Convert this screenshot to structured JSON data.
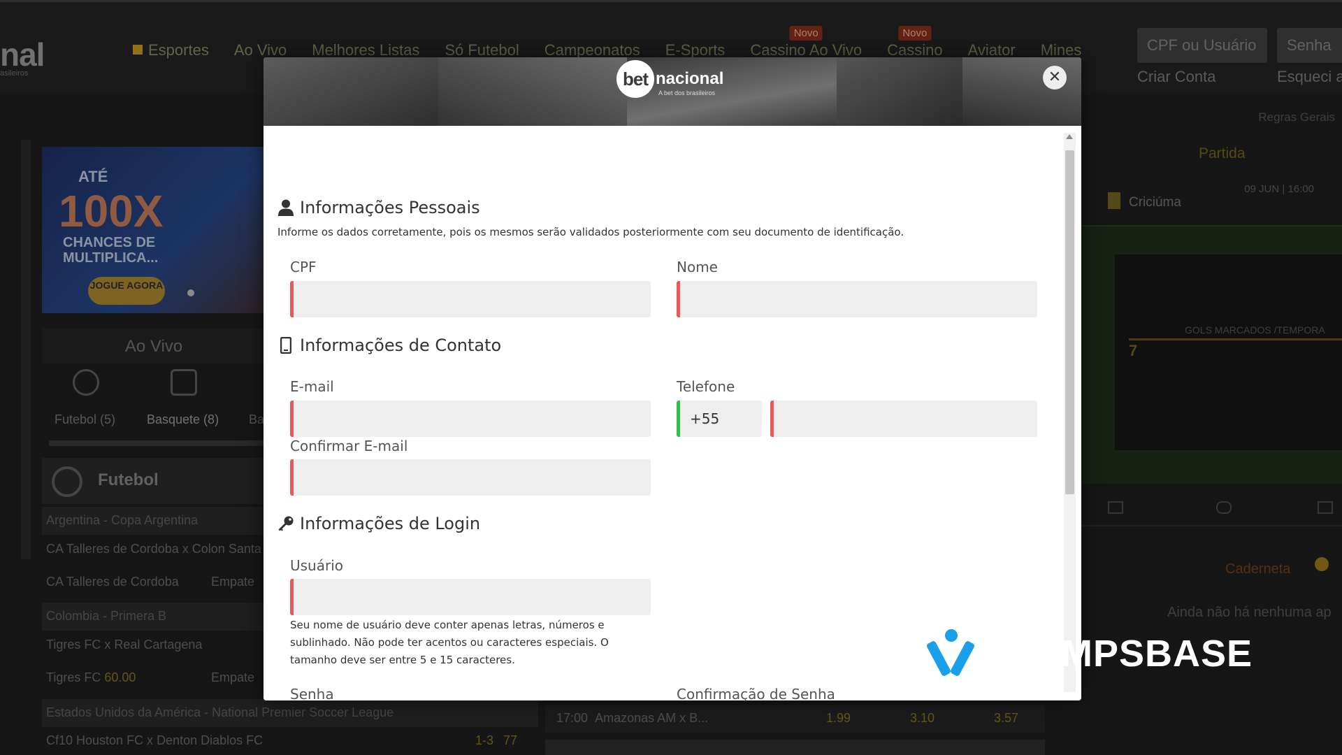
{
  "background": {
    "logo_fragment": "nal",
    "logo_sub_fragment": "asileiros",
    "nav": [
      {
        "label": "Esportes"
      },
      {
        "label": "Ao Vivo"
      },
      {
        "label": "Melhores Listas"
      },
      {
        "label": "Só Futebol"
      },
      {
        "label": "Campeonatos"
      },
      {
        "label": "E-Sports"
      },
      {
        "label": "Cassino Ao Vivo",
        "badge": "Novo"
      },
      {
        "label": "Cassino",
        "badge": "Novo"
      },
      {
        "label": "Aviator"
      },
      {
        "label": "Mines"
      }
    ],
    "login": {
      "user_placeholder": "CPF ou Usuário",
      "password_placeholder": "Senha",
      "create_account": "Criar Conta",
      "forgot": "Esqueci a"
    },
    "banner": {
      "line1": "ATÉ",
      "big": "100X",
      "line2": "CHANCES DE MULTIPLICA...",
      "button": "JOGUE AGORA"
    },
    "live_title": "Ao Vivo",
    "sport_tabs": [
      "Futebol (5)",
      "Basquete (8)",
      "Ba"
    ],
    "section_title": "Futebol",
    "rows": [
      {
        "type": "cat",
        "text": "Argentina - Copa Argentina"
      },
      {
        "type": "match",
        "text": "CA Talleres de Cordoba x Colon Santa Fe"
      },
      {
        "type": "odds",
        "text": "CA Talleres de Cordoba",
        "right": "Empate"
      },
      {
        "type": "cat",
        "text": "Colombia - Primera B"
      },
      {
        "type": "match",
        "text": "Tigres FC x Real Cartagena"
      },
      {
        "type": "odds",
        "text": "Tigres FC",
        "odd": "60.00",
        "right": "Empate"
      },
      {
        "type": "cat",
        "text": "Estados Unidos da América - National Premier Soccer League"
      },
      {
        "type": "match",
        "text": "Cf10 Houston FC x Denton Diablos FC",
        "score": "1-3",
        "minute": "77"
      }
    ],
    "center_row": {
      "time": "17:00",
      "match": "Amazonas AM x B...",
      "odds": [
        "1.99",
        "3.10",
        "3.57"
      ]
    },
    "right_panel": {
      "rules": "Regras Gerais",
      "tab": "Partida",
      "date": "09 JUN | 16:00",
      "team": "Criciúma",
      "stat_label": "GOLS MARCADOS /TEMPORA",
      "stat_value": "7",
      "betslip": "Caderneta",
      "betslip_empty": "Ainda não há nenhuma ap"
    }
  },
  "modal": {
    "brand": {
      "bet": "bet",
      "nacional": "nacional",
      "tagline": "A bet dos brasileiros"
    },
    "close_symbol": "✕",
    "sections": {
      "personal": {
        "title": "Informações Pessoais",
        "info": "Informe os dados corretamente, pois os mesmos serão validados posteriormente com seu documento de identificação.",
        "cpf_label": "CPF",
        "name_label": "Nome"
      },
      "contact": {
        "title": "Informações de Contato",
        "email_label": "E-mail",
        "phone_label": "Telefone",
        "phone_prefix": "+55",
        "confirm_email_label": "Confirmar E-mail"
      },
      "login": {
        "title": "Informações de Login",
        "user_label": "Usuário",
        "user_help": "Seu nome de usuário deve conter apenas letras, números e sublinhado. Não pode ter acentos ou caracteres especiais. O tamanho deve ser entre 5 e 15 caracteres.",
        "password_label": "Senha",
        "password_confirm_label": "Confirmação de Senha"
      }
    },
    "field_values": {
      "cpf": "",
      "name": "",
      "email": "",
      "phone": "",
      "confirm_email": "",
      "user": "",
      "password": "",
      "password_confirm": ""
    },
    "colors": {
      "invalid": "#e85a5a",
      "valid": "#2fbf4a"
    }
  },
  "watermark": {
    "text": "CHAMPSBASE"
  }
}
